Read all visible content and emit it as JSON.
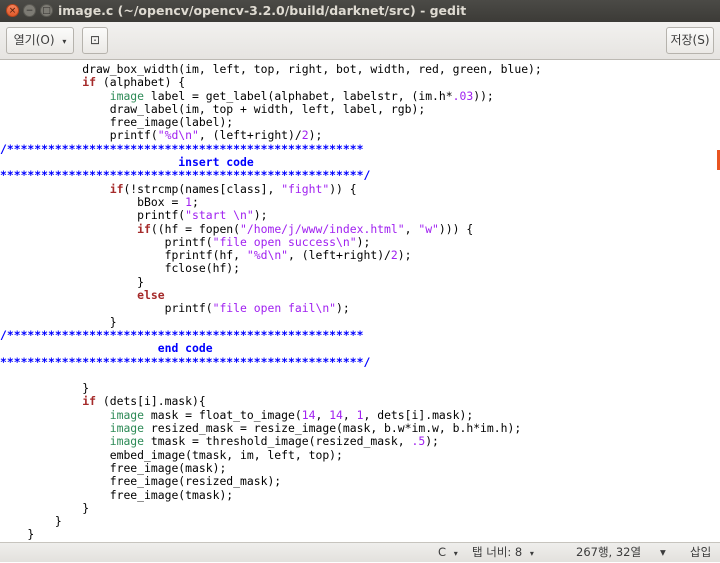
{
  "window": {
    "title": "image.c (~/opencv/opencv-3.2.0/build/darknet/src) - gedit"
  },
  "toolbar": {
    "open_label": "열기(O)",
    "open_arrow": "▾",
    "new_tab_icon": "⊡",
    "save_label": "저장(S)"
  },
  "editor": {
    "lines": [
      "            draw_box_width(im, left, top, right, bot, width, red, green, blue);",
      "            if (alphabet) {",
      "                image label = get_label(alphabet, labelstr, (im.h*.03));",
      "                draw_label(im, top + width, left, label, rgb);",
      "                free_image(label);",
      "                printf(\"%d\\n\", (left+right)/2);",
      "/****************************************************",
      "                          insert code",
      "*****************************************************/",
      "                if(!strcmp(names[class], \"fight\")) {",
      "                    bBox = 1;",
      "                    printf(\"start \\n\");",
      "                    if((hf = fopen(\"/home/j/www/index.html\", \"w\"))) {",
      "                        printf(\"file open success\\n\");",
      "                        fprintf(hf, \"%d\\n\", (left+right)/2);",
      "                        fclose(hf);",
      "                    }",
      "                    else",
      "                        printf(\"file open fail\\n\");",
      "                }",
      "/****************************************************",
      "                       end code",
      "*****************************************************/",
      "",
      "            }",
      "            if (dets[i].mask){",
      "                image mask = float_to_image(14, 14, 1, dets[i].mask);",
      "                image resized_mask = resize_image(mask, b.w*im.w, b.h*im.h);",
      "                image tmask = threshold_image(resized_mask, .5);",
      "                embed_image(tmask, im, left, top);",
      "                free_image(mask);",
      "                free_image(resized_mask);",
      "                free_image(tmask);",
      "            }",
      "        }",
      "    }"
    ]
  },
  "statusbar": {
    "language": "C",
    "tab_width": "탭 너비: 8",
    "position": "267행, 32열",
    "mode": "삽입",
    "arrow": "▾"
  },
  "colors": {
    "keyword": "#a52a2a",
    "type": "#2e8b57",
    "string": "#a020f0",
    "comment": "#0000ff",
    "titlebar": "#3c3b37",
    "close_button": "#e95420"
  }
}
